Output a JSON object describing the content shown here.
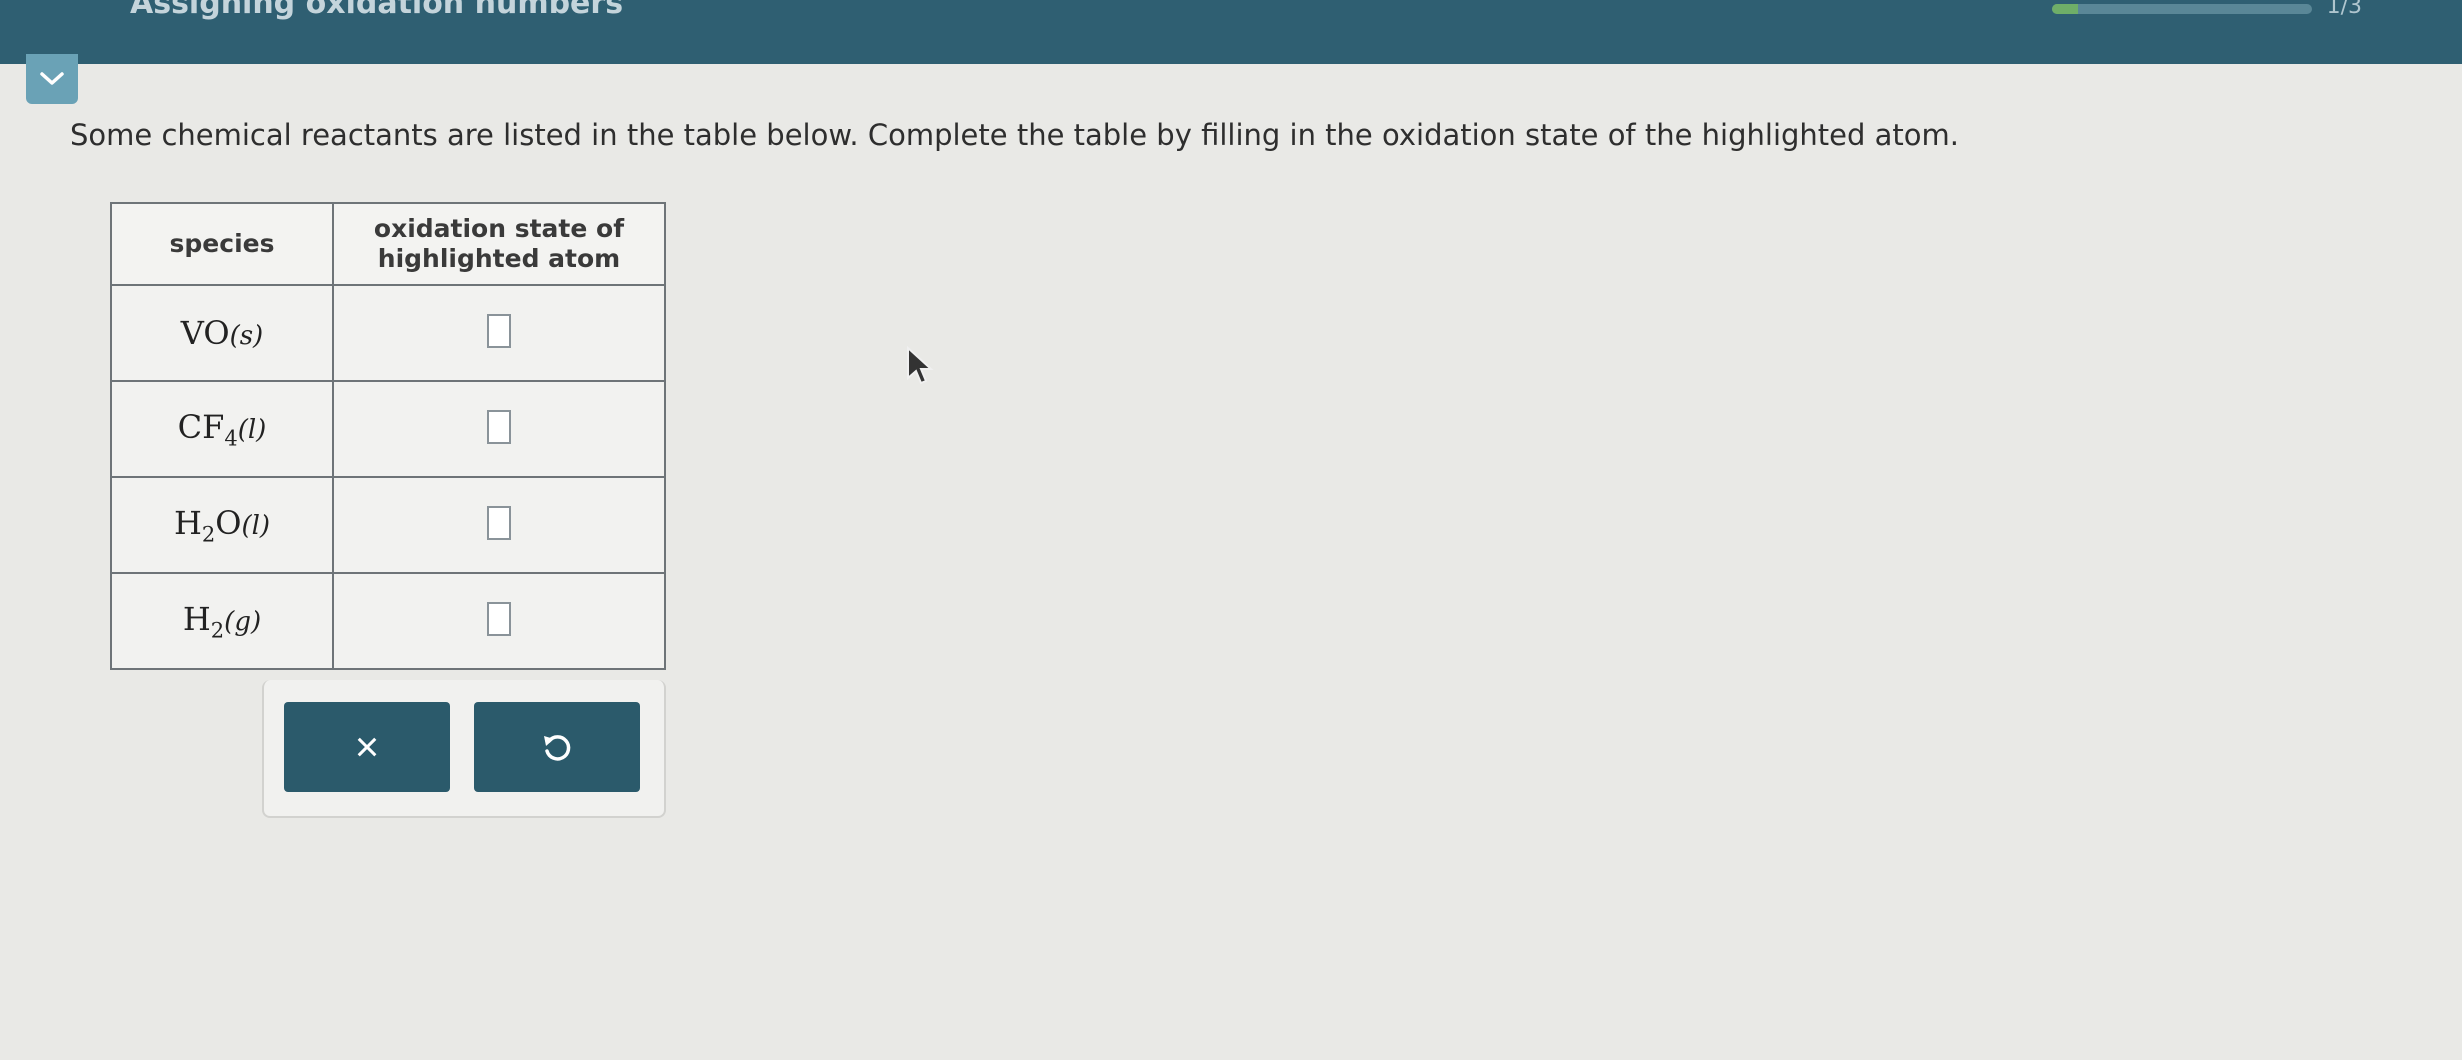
{
  "header": {
    "title": "Assigning oxidation numbers",
    "progress_fraction": 0.1,
    "progress_count": "1/3"
  },
  "prompt_text": "Some chemical reactants are listed in the table below. Complete the table by filling in the oxidation state of the highlighted atom.",
  "table": {
    "headers": [
      "species",
      "oxidation state of highlighted atom"
    ],
    "rows": [
      {
        "species": {
          "parts": [
            [
              "VO",
              ""
            ],
            [
              "(s)",
              "state"
            ]
          ]
        },
        "answer": ""
      },
      {
        "species": {
          "parts": [
            [
              "CF",
              ""
            ],
            [
              "4",
              "sub"
            ],
            [
              "(l)",
              "state"
            ]
          ]
        },
        "answer": ""
      },
      {
        "species": {
          "parts": [
            [
              "H",
              ""
            ],
            [
              "2",
              "sub"
            ],
            [
              "O",
              ""
            ],
            [
              "(l)",
              "state"
            ]
          ]
        },
        "answer": ""
      },
      {
        "species": {
          "parts": [
            [
              "H",
              ""
            ],
            [
              "2",
              "sub"
            ],
            [
              "(g)",
              "state"
            ]
          ]
        },
        "answer": ""
      }
    ]
  },
  "buttons": {
    "clear_symbol": "×",
    "undo_symbol": "↺"
  },
  "colors": {
    "header_bar": "#2f5f72",
    "button": "#2b5a6b",
    "collapse_tab": "#6aa2b6",
    "background": "#e9e9e6"
  },
  "icons": [
    "chevron-down-icon",
    "close-icon",
    "undo-icon",
    "mouse-pointer-icon"
  ]
}
